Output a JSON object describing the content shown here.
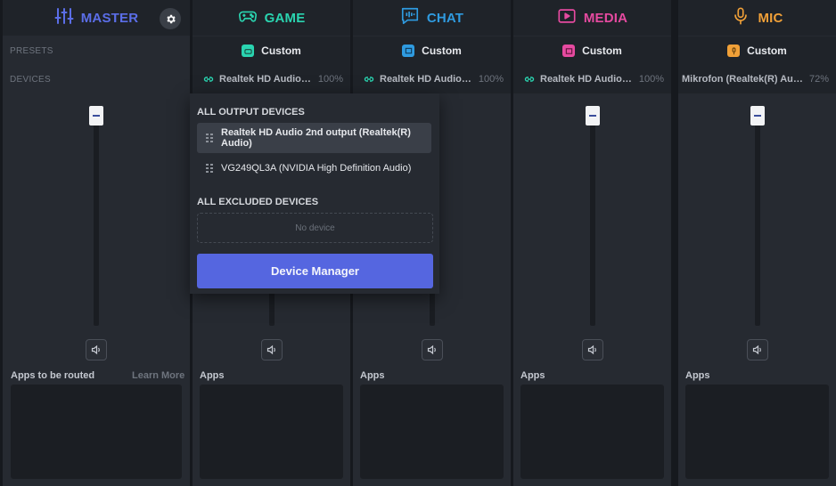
{
  "colors": {
    "master": "#5b6ee8",
    "game": "#2ad4b0",
    "chat": "#2f9be0",
    "media": "#e64aa0",
    "mic": "#f0a038",
    "accent_button": "#5566e0"
  },
  "labels": {
    "presets": "PRESETS",
    "devices": "DEVICES"
  },
  "master": {
    "title": "MASTER",
    "apps_label": "Apps to be routed",
    "learn_more": "Learn More",
    "settings_icon": "gear-icon",
    "volume_level": 1.0
  },
  "channels": [
    {
      "id": "game",
      "title": "GAME",
      "preset": "Custom",
      "device": "Realtek HD Audio 2n...",
      "volume": "100%",
      "apps_label": "Apps",
      "volume_level": 1.0,
      "icon": "gamepad-icon"
    },
    {
      "id": "chat",
      "title": "CHAT",
      "preset": "Custom",
      "device": "Realtek HD Audio 2n...",
      "volume": "100%",
      "apps_label": "Apps",
      "volume_level": 1.0,
      "icon": "chat-bubble-icon"
    },
    {
      "id": "media",
      "title": "MEDIA",
      "preset": "Custom",
      "device": "Realtek HD Audio 2n...",
      "volume": "100%",
      "apps_label": "Apps",
      "volume_level": 1.0,
      "icon": "play-screen-icon"
    },
    {
      "id": "mic",
      "title": "MIC",
      "preset": "Custom",
      "device": "Mikrofon (Realtek(R) Audi...",
      "volume": "72%",
      "apps_label": "Apps",
      "volume_level": 1.0,
      "icon": "microphone-icon"
    }
  ],
  "dropdown": {
    "output_heading": "ALL OUTPUT DEVICES",
    "output_devices": [
      {
        "label": "Realtek HD Audio 2nd output (Realtek(R) Audio)",
        "selected": true
      },
      {
        "label": "VG249QL3A (NVIDIA High Definition Audio)",
        "selected": false
      }
    ],
    "excluded_heading": "ALL EXCLUDED DEVICES",
    "no_device": "No device",
    "manager_button": "Device Manager"
  }
}
